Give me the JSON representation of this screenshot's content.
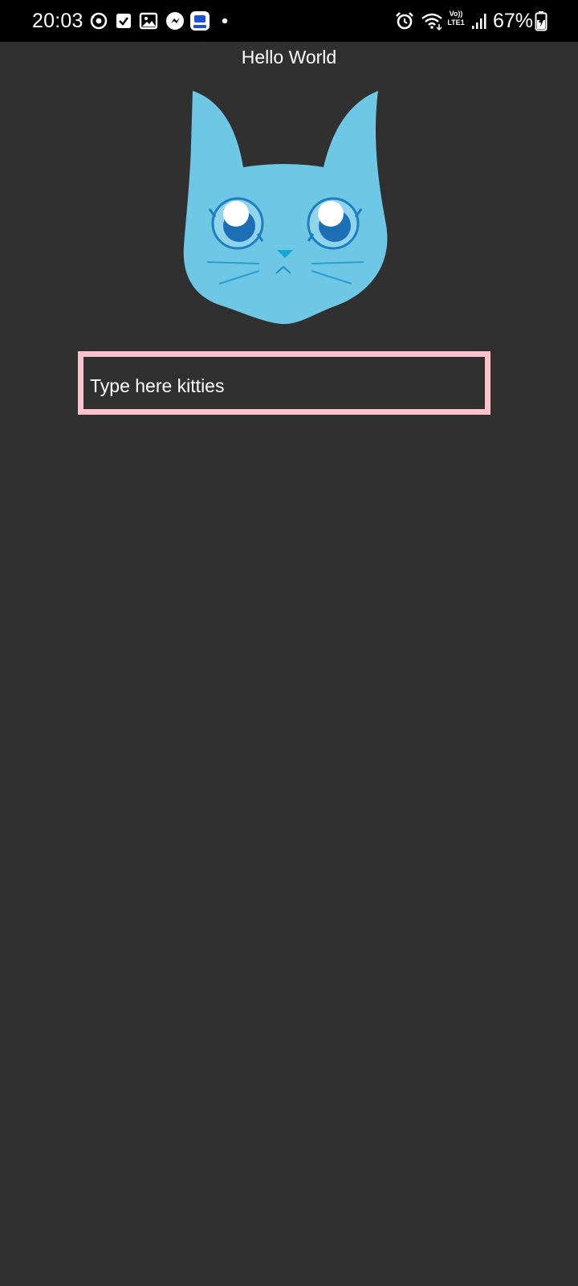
{
  "status_bar": {
    "time": "20:03",
    "battery_percent": "67%",
    "network_label_top": "Vo))",
    "network_label_bottom": "LTE1",
    "left_icons": [
      "sync-icon",
      "check-box-icon",
      "gallery-icon",
      "messenger-icon",
      "app-icon",
      "more-dot-icon"
    ],
    "right_icons": [
      "alarm-icon",
      "wifi-icon",
      "volte-icon",
      "signal-icon",
      "battery-charging-icon"
    ]
  },
  "main": {
    "greeting": "Hello World",
    "image": "cat-face-icon",
    "input": {
      "value": "Type here kitties",
      "border_color": "#fdc3cd"
    }
  },
  "colors": {
    "background": "#303030",
    "status_bar": "#000000",
    "cat": "#6ec7e4",
    "cat_eye": "#1c7fc0"
  }
}
